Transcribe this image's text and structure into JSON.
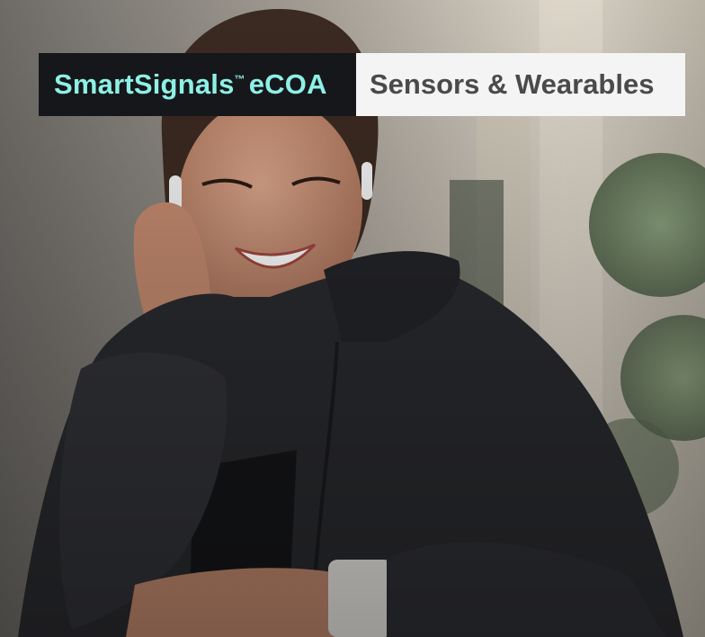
{
  "banner": {
    "brand_name": "SmartSignals",
    "trademark": "™",
    "brand_suffix": "eCOA",
    "topic": "Sensors & Wearables"
  },
  "colors": {
    "brand_background": "#16171a",
    "brand_text": "#8ef0e6",
    "topic_background": "#f4f4f4",
    "topic_text": "#4a4a4a"
  }
}
